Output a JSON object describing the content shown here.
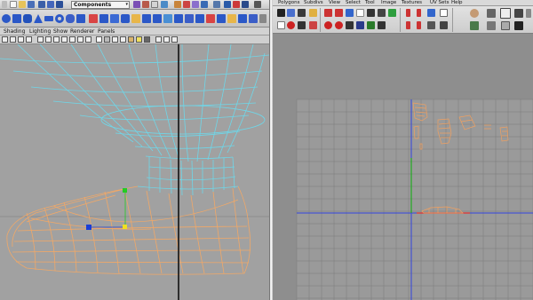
{
  "shelf": {
    "selection_mode_value": "Components"
  },
  "panel_menu": {
    "items": [
      "Shading",
      "Lighting",
      "Show",
      "Renderer",
      "Panels"
    ]
  },
  "uv_editor": {
    "menu": [
      "Polygons",
      "Subdivs",
      "View",
      "Select",
      "Tool",
      "Image",
      "Textures",
      "UV Sets",
      "Help"
    ]
  },
  "colors": {
    "wire_upper": "#6fd6e8",
    "wire_foot": "#f0a868",
    "manip_green": "#22cc22",
    "manip_blue": "#1a3fd6",
    "manip_yellow": "#f0e020",
    "axis_blue": "#3344dd",
    "axis_green": "#22aa22",
    "uv_shells": "#f0a060",
    "uv_red_line": "#e23030"
  },
  "icons": [
    "move-tool-icon",
    "rotate-tool-icon",
    "scale-tool-icon",
    "polygon-primitive-icons",
    "grid-icon",
    "uv-flip-icon",
    "uv-rotate-icon",
    "uv-layout-icon",
    "snapshot-icon"
  ]
}
